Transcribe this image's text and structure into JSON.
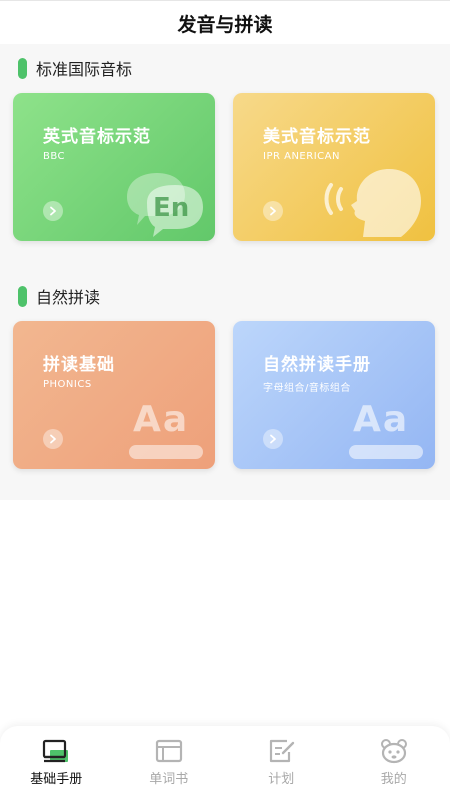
{
  "header": {
    "title": "发音与拼读"
  },
  "sections": [
    {
      "title": "标准国际音标",
      "cards": [
        {
          "title": "英式音标示范",
          "subtitle": "BBC"
        },
        {
          "title": "美式音标示范",
          "subtitle": "IPR ANERICAN"
        }
      ]
    },
    {
      "title": "自然拼读",
      "cards": [
        {
          "title": "拼读基础",
          "subtitle": "PHONICS"
        },
        {
          "title": "自然拼读手册",
          "subtitle": "字母组合/音标组合"
        }
      ]
    }
  ],
  "art": {
    "en": "En",
    "aa": "Aa"
  },
  "tabs": [
    {
      "label": "基础手册",
      "icon": "book-stack-icon",
      "active": true
    },
    {
      "label": "单词书",
      "icon": "notebook-icon",
      "active": false
    },
    {
      "label": "计划",
      "icon": "edit-note-icon",
      "active": false
    },
    {
      "label": "我的",
      "icon": "bear-face-icon",
      "active": false
    }
  ],
  "colors": {
    "accent": "#4ec26a",
    "card_green": "#6fd174",
    "card_yellow": "#f3c955",
    "card_orange": "#efa983",
    "card_blue": "#a2c2f6"
  }
}
